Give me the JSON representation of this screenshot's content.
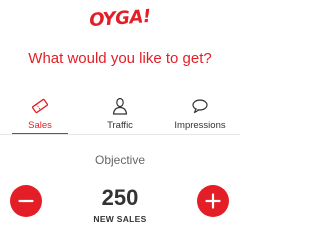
{
  "brand": {
    "logo_text": "OYGA!",
    "accent_color": "#e31e26"
  },
  "heading": "What would you like to get?",
  "tabs": [
    {
      "label": "Sales",
      "icon": "ticket-icon",
      "active": true
    },
    {
      "label": "Traffic",
      "icon": "person-icon",
      "active": false
    },
    {
      "label": "Impressions",
      "icon": "speech-bubble-icon",
      "active": false
    }
  ],
  "objective": {
    "label": "Objective",
    "value": "250",
    "unit": "NEW SALES",
    "decrease_icon": "minus-icon",
    "increase_icon": "plus-icon"
  }
}
